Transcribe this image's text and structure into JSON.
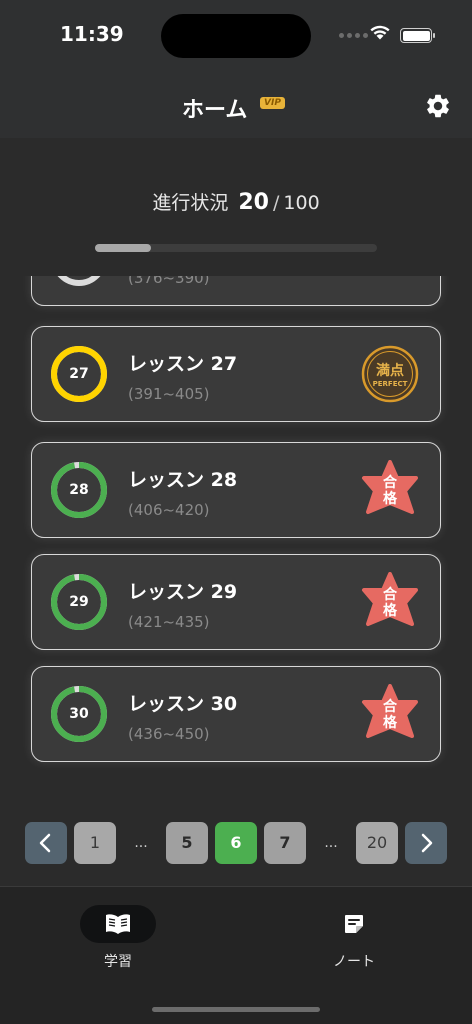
{
  "status_bar": {
    "time": "11:39"
  },
  "header": {
    "title": "ホーム",
    "vip_badge": "VIP",
    "settings_icon": "gear-icon"
  },
  "progress": {
    "label": "進行状況",
    "current": "20",
    "separator": "/",
    "total": "100",
    "fraction": 0.2
  },
  "lessons": [
    {
      "title": "",
      "number": "",
      "range": "(376~390)",
      "ring_color": "#2196f3",
      "ring_fraction": 0.3,
      "badge": "none"
    },
    {
      "title": "レッスン 27",
      "number": "27",
      "range": "(391~405)",
      "ring_color": "#ffd400",
      "ring_fraction": 1.0,
      "badge": "perfect"
    },
    {
      "title": "レッスン 28",
      "number": "28",
      "range": "(406~420)",
      "ring_color": "#4caf50",
      "ring_fraction": 0.97,
      "badge": "pass"
    },
    {
      "title": "レッスン 29",
      "number": "29",
      "range": "(421~435)",
      "ring_color": "#4caf50",
      "ring_fraction": 0.97,
      "badge": "pass"
    },
    {
      "title": "レッスン 30",
      "number": "30",
      "range": "(436~450)",
      "ring_color": "#4caf50",
      "ring_fraction": 0.97,
      "badge": "pass"
    }
  ],
  "badges": {
    "perfect": {
      "main": "満点",
      "sub": "PERFECT",
      "color": "#d99a2b"
    },
    "pass": {
      "line1": "合",
      "line2": "格",
      "color": "#e66a62"
    }
  },
  "pagination": {
    "prev_icon": "chevron-left-icon",
    "next_icon": "chevron-right-icon",
    "first": "1",
    "ellipsis": "...",
    "pages": [
      "5",
      "6",
      "7"
    ],
    "active": "6",
    "last": "20"
  },
  "tabs": [
    {
      "label": "学習",
      "icon": "book-icon",
      "active": true
    },
    {
      "label": "ノート",
      "icon": "note-icon",
      "active": false
    }
  ]
}
